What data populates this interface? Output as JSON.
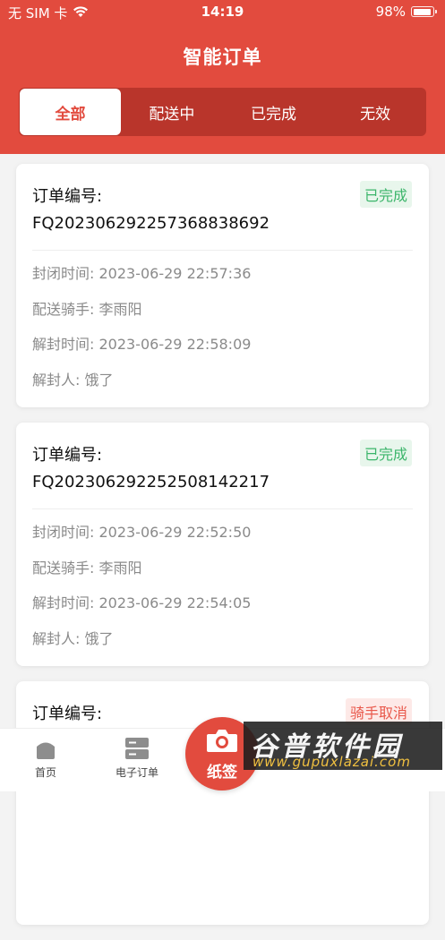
{
  "status_bar": {
    "carrier": "无 SIM 卡",
    "time": "14:19",
    "battery": "98%",
    "battery_level": 0.98
  },
  "page": {
    "title": "智能订单"
  },
  "tabs": [
    {
      "label": "全部",
      "active": true
    },
    {
      "label": "配送中",
      "active": false
    },
    {
      "label": "已完成",
      "active": false
    },
    {
      "label": "无效",
      "active": false
    }
  ],
  "orders": [
    {
      "title": "订单编号:",
      "order_no": "FQ202306292257368838692",
      "status": "已完成",
      "rows": [
        {
          "label": "封闭时间:",
          "value": "2023-06-29 22:57:36"
        },
        {
          "label": "配送骑手:",
          "value": "李雨阳"
        },
        {
          "label": "解封时间:",
          "value": "2023-06-29 22:58:09"
        },
        {
          "label": "解封人:",
          "value": "饿了"
        }
      ]
    },
    {
      "title": "订单编号:",
      "order_no": "FQ202306292252508142217",
      "status": "已完成",
      "rows": [
        {
          "label": "封闭时间:",
          "value": "2023-06-29 22:52:50"
        },
        {
          "label": "配送骑手:",
          "value": "李雨阳"
        },
        {
          "label": "解封时间:",
          "value": "2023-06-29 22:54:05"
        },
        {
          "label": "解封人:",
          "value": "饿了"
        }
      ]
    },
    {
      "title": "订单编号:",
      "status": "骑手取消"
    }
  ],
  "tabbar": {
    "home": "首页",
    "e_order": "电子订单",
    "fab": "纸签"
  },
  "watermark": {
    "main": "谷普软件园",
    "url": "www.gupuxlazai.com"
  },
  "colors": {
    "brand": "#e24b3e",
    "done": "#3bb56a",
    "cancel": "#e9594c"
  }
}
